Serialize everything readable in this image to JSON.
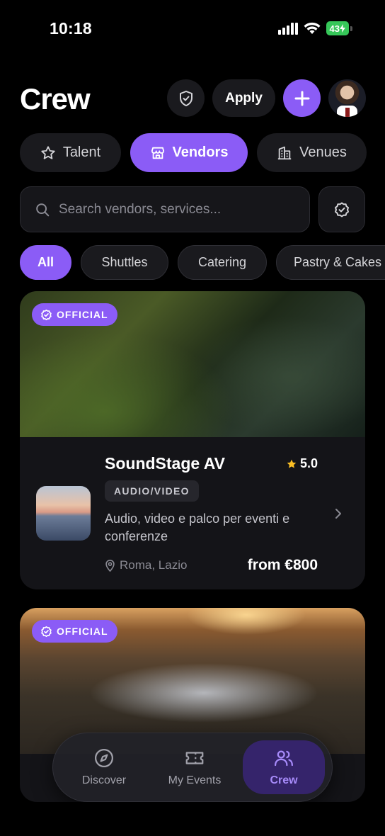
{
  "status_bar": {
    "time": "10:18",
    "battery": "43"
  },
  "header": {
    "title": "Crew",
    "apply_label": "Apply"
  },
  "segments": [
    {
      "label": "Talent",
      "icon": "star-icon",
      "active": false
    },
    {
      "label": "Vendors",
      "icon": "store-icon",
      "active": true
    },
    {
      "label": "Venues",
      "icon": "building-icon",
      "active": false
    }
  ],
  "search": {
    "placeholder": "Search vendors, services..."
  },
  "chips": [
    {
      "label": "All",
      "active": true
    },
    {
      "label": "Shuttles",
      "active": false
    },
    {
      "label": "Catering",
      "active": false
    },
    {
      "label": "Pastry & Cakes",
      "active": false
    }
  ],
  "vendors": [
    {
      "badge": "OFFICIAL",
      "name": "SoundStage AV",
      "rating": "5.0",
      "category": "AUDIO/VIDEO",
      "description": "Audio, video e palco per eventi e conferenze",
      "location": "Roma, Lazio",
      "price": "from €800"
    },
    {
      "badge": "OFFICIAL"
    }
  ],
  "bottom_nav": [
    {
      "label": "Discover",
      "icon": "compass-icon",
      "active": false
    },
    {
      "label": "My Events",
      "icon": "ticket-icon",
      "active": false
    },
    {
      "label": "Crew",
      "icon": "users-icon",
      "active": true
    }
  ],
  "colors": {
    "accent": "#8b5cf6",
    "background": "#000000",
    "surface": "#1a1a1e",
    "star": "#fbbf24"
  }
}
